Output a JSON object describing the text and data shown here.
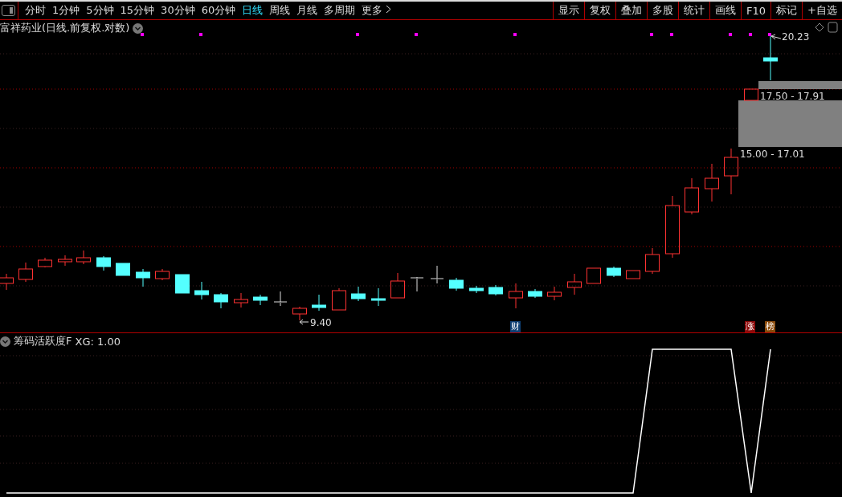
{
  "toolbar": {
    "periods": [
      {
        "label": "分时",
        "selected": false
      },
      {
        "label": "1分钟",
        "selected": false
      },
      {
        "label": "5分钟",
        "selected": false
      },
      {
        "label": "15分钟",
        "selected": false
      },
      {
        "label": "30分钟",
        "selected": false
      },
      {
        "label": "60分钟",
        "selected": false
      },
      {
        "label": "日线",
        "selected": true
      },
      {
        "label": "周线",
        "selected": false
      },
      {
        "label": "月线",
        "selected": false
      },
      {
        "label": "多周期",
        "selected": false
      }
    ],
    "more": "更多",
    "buttons": [
      "显示",
      "复权",
      "叠加",
      "多股",
      "统计",
      "画线",
      "F10",
      "标记",
      "+自选"
    ]
  },
  "main_chart": {
    "title": "富祥药业(日线.前复权.对数)",
    "high_label": "20.23",
    "low_label": "9.40",
    "ranges": [
      {
        "label": "17.50 - 17.91"
      },
      {
        "label": "15.00 - 17.01"
      }
    ],
    "markers": [
      {
        "label": "财",
        "color": "#0f3f73"
      },
      {
        "label": "涨",
        "color": "#8c0b0b"
      },
      {
        "label": "榜",
        "color": "#8a4a0a"
      }
    ]
  },
  "indicator": {
    "name": "筹码活跃度F",
    "reading": "XG: 1.00"
  }
}
